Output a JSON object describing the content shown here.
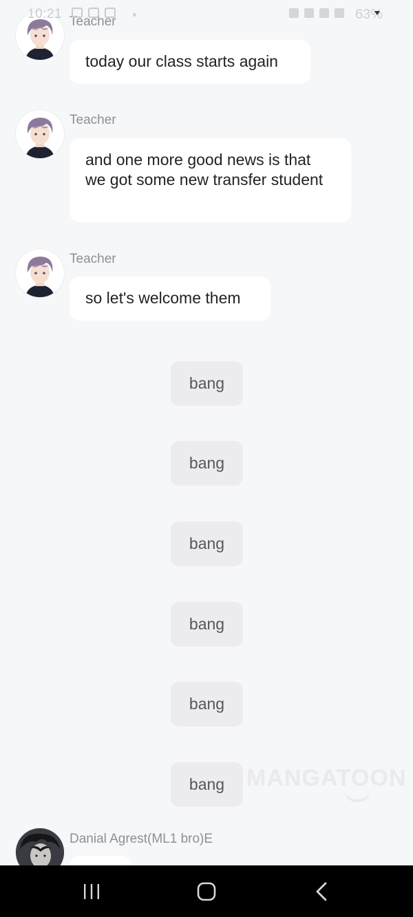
{
  "status_bar": {
    "time": "10:21",
    "battery": "63%"
  },
  "messages": [
    {
      "sender": "Teacher",
      "text": "today our class starts again"
    },
    {
      "sender": "Teacher",
      "text": "and one more good news is that we got some new transfer student"
    },
    {
      "sender": "Teacher",
      "text": "so let's welcome them"
    }
  ],
  "system_messages": [
    "bang",
    "bang",
    "bang",
    "bang",
    "bang",
    "bang"
  ],
  "last_message": {
    "sender": "Danial Agrest(ML1 bro)E"
  },
  "watermark": "MANGATOON",
  "colors": {
    "background": "#f6f7f9",
    "bubble": "#ffffff",
    "system_bubble": "#ececee",
    "nav_bar": "#000000"
  },
  "icons": {
    "nav_recent": "recent-apps-icon",
    "nav_home": "home-icon",
    "nav_back": "back-icon"
  }
}
